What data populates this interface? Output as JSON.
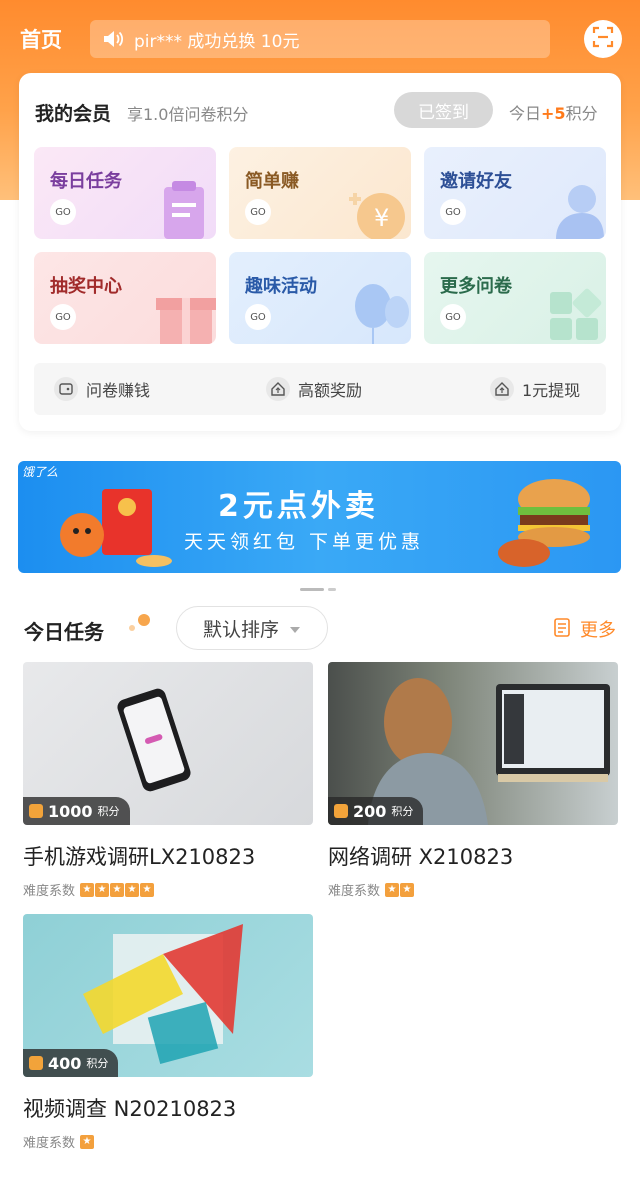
{
  "header": {
    "title": "首页",
    "notice": "pir*** 成功兑换 10元"
  },
  "member": {
    "title": "我的会员",
    "subtitle": "享1.0倍问卷积分",
    "signed_label": "已签到",
    "today_prefix": "今日",
    "today_plus": "+5",
    "today_suffix": "积分"
  },
  "tiles": [
    {
      "label": "每日任务",
      "go": "GO"
    },
    {
      "label": "简单赚",
      "go": "GO"
    },
    {
      "label": "邀请好友",
      "go": "GO"
    },
    {
      "label": "抽奖中心",
      "go": "GO"
    },
    {
      "label": "趣味活动",
      "go": "GO"
    },
    {
      "label": "更多问卷",
      "go": "GO"
    }
  ],
  "quick_links": [
    {
      "label": "问卷赚钱",
      "icon": "wallet-icon"
    },
    {
      "label": "高额奖励",
      "icon": "house-up-icon"
    },
    {
      "label": "1元提现",
      "icon": "house-up-icon"
    }
  ],
  "banner": {
    "brand": "饿了么",
    "title": "2元点外卖",
    "subtitle": "天天领红包 下单更优惠"
  },
  "tasks_section": {
    "title": "今日任务",
    "sort_label": "默认排序",
    "more_label": "更多"
  },
  "tasks": [
    {
      "points": "1000",
      "unit": "积分",
      "name": "手机游戏调研LX210823",
      "difficulty_label": "难度系数",
      "stars": 5
    },
    {
      "points": "200",
      "unit": "积分",
      "name": "网络调研 X210823",
      "difficulty_label": "难度系数",
      "stars": 2
    },
    {
      "points": "400",
      "unit": "积分",
      "name": "视频调查 N20210823",
      "difficulty_label": "难度系数",
      "stars": 1
    }
  ],
  "colors": {
    "accent": "#ff8a2a",
    "banner_blue": "#2b97f3"
  }
}
